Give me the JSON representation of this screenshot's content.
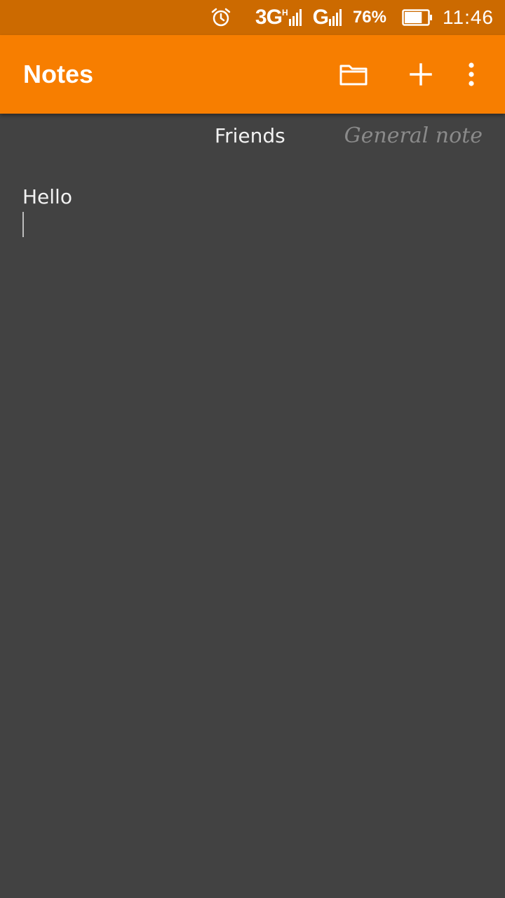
{
  "status_bar": {
    "alarm_icon": "alarm-clock-icon",
    "network_3g": "3G",
    "network_h": "H",
    "network_g": "G",
    "battery_percent": "76%",
    "battery_level": 0.76,
    "time": "11:46"
  },
  "app_bar": {
    "title": "Notes",
    "background": "#f77e00",
    "actions": {
      "folder_icon": "folder-icon",
      "add_icon": "plus-icon",
      "more_icon": "more-vertical-icon"
    }
  },
  "tabs": [
    {
      "label": "Friends",
      "selected": true
    },
    {
      "label": "General note",
      "selected": false
    }
  ],
  "note": {
    "text": "Hello"
  },
  "colors": {
    "status_bar": "#cc6a00",
    "accent": "#f77e00",
    "background": "#424242",
    "text_primary": "#f2f2f2",
    "text_inactive": "#8a8a8a"
  }
}
